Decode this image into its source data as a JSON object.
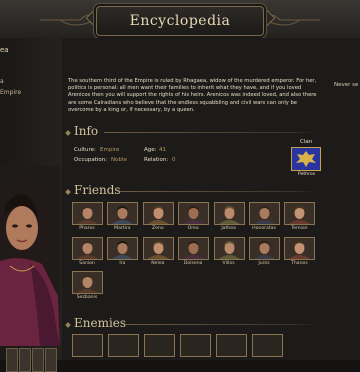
{
  "header": {
    "title": "Encyclopedia"
  },
  "left_panel": {
    "name_fragment": "ea",
    "line1": "a",
    "line2": "Empire"
  },
  "description": "The southern third of the Empire is ruled by Rhagaea, widow of the murdered emperor. For her, politics is personal: all men want their families to inherit what they have, and if you loved Arenicos then you will support the rights of his heirs. Arenicos was indeed loved, and also there are some Calradians who believe that the endless squabbling and civil wars can only be overcome by a king or, if necessary, by a queen.",
  "side_note": "Never se",
  "sections": {
    "info": "Info",
    "friends": "Friends",
    "enemies": "Enemies"
  },
  "info": {
    "culture_label": "Culture:",
    "culture_value": "Empire",
    "occupation_label": "Occupation:",
    "occupation_value": "Noble",
    "age_label": "Age:",
    "age_value": "41",
    "relation_label": "Relation:",
    "relation_value": "0",
    "clan_label": "Clan",
    "clan_name": "Pethros"
  },
  "friends": [
    "Pharos",
    "Martira",
    "Zeno",
    "Orea",
    "Jathea",
    "Honoratas",
    "Temion",
    "Sanion",
    "Ira",
    "Nelea",
    "Dolsena",
    "Villos",
    "Juros",
    "Thanos",
    "Sezbanis"
  ],
  "colors": {
    "accent": "#b69a5f",
    "frame": "#8a744f",
    "banner": "#2a34a0"
  }
}
